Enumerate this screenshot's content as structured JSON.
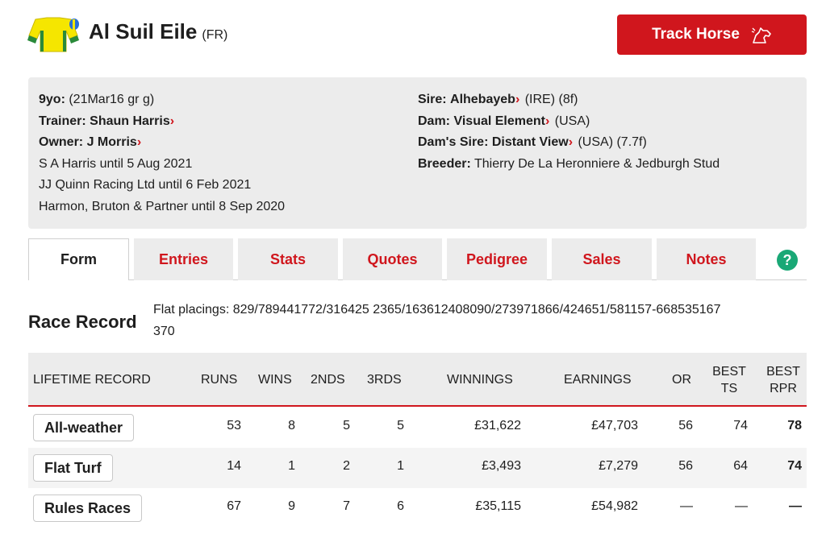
{
  "header": {
    "horse_name": "Al Suil Eile",
    "country": "(FR)",
    "track_button": "Track Horse",
    "silks_colors": {
      "primary": "#f5e600",
      "secondary": "#2a8a3a",
      "cap": "#2a6fd6"
    },
    "accent_color": "#d0161d"
  },
  "info": {
    "left": [
      {
        "label": "9yo:",
        "value": " (21Mar16 gr g)"
      },
      {
        "label": "Trainer:",
        "link": "Shaun Harris"
      },
      {
        "label": "Owner:",
        "link": "J Morris"
      },
      {
        "text": "S A Harris until 5 Aug 2021"
      },
      {
        "text": "JJ Quinn Racing Ltd until 6 Feb 2021"
      },
      {
        "text": "Harmon, Bruton & Partner until 8 Sep 2020"
      }
    ],
    "right": [
      {
        "label": "Sire:",
        "link": "Alhebayeb",
        "suffix": " (IRE) (8f)"
      },
      {
        "label": "Dam:",
        "link": "Visual Element",
        "suffix": " (USA)"
      },
      {
        "label": "Dam's Sire:",
        "link": "Distant View",
        "suffix": " (USA) (7.7f)"
      },
      {
        "label": "Breeder:",
        "value": " Thierry De La Heronniere & Jedburgh Stud"
      }
    ]
  },
  "tabs": [
    "Form",
    "Entries",
    "Stats",
    "Quotes",
    "Pedigree",
    "Sales",
    "Notes"
  ],
  "help_icon": "?",
  "race_record": {
    "title": "Race Record",
    "placings_label": "Flat placings: ",
    "placings_line1": "829/789441772/316425 2365/163612408090/273971866/424651/581157-668535167",
    "placings_line2": "370"
  },
  "table": {
    "headers": [
      "LIFETIME RECORD",
      "RUNS",
      "WINS",
      "2NDS",
      "3RDS",
      "WINNINGS",
      "EARNINGS",
      "OR",
      "BEST TS",
      "BEST RPR"
    ],
    "rows": [
      {
        "name": "All-weather",
        "runs": "53",
        "wins": "8",
        "seconds": "5",
        "thirds": "5",
        "winnings": "£31,622",
        "earnings": "£47,703",
        "or": "56",
        "best_ts": "74",
        "best_rpr": "78"
      },
      {
        "name": "Flat Turf",
        "runs": "14",
        "wins": "1",
        "seconds": "2",
        "thirds": "1",
        "winnings": "£3,493",
        "earnings": "£7,279",
        "or": "56",
        "best_ts": "64",
        "best_rpr": "74"
      },
      {
        "name": "Rules Races",
        "runs": "67",
        "wins": "9",
        "seconds": "7",
        "thirds": "6",
        "winnings": "£35,115",
        "earnings": "£54,982",
        "or": "—",
        "best_ts": "—",
        "best_rpr": "—"
      }
    ]
  }
}
